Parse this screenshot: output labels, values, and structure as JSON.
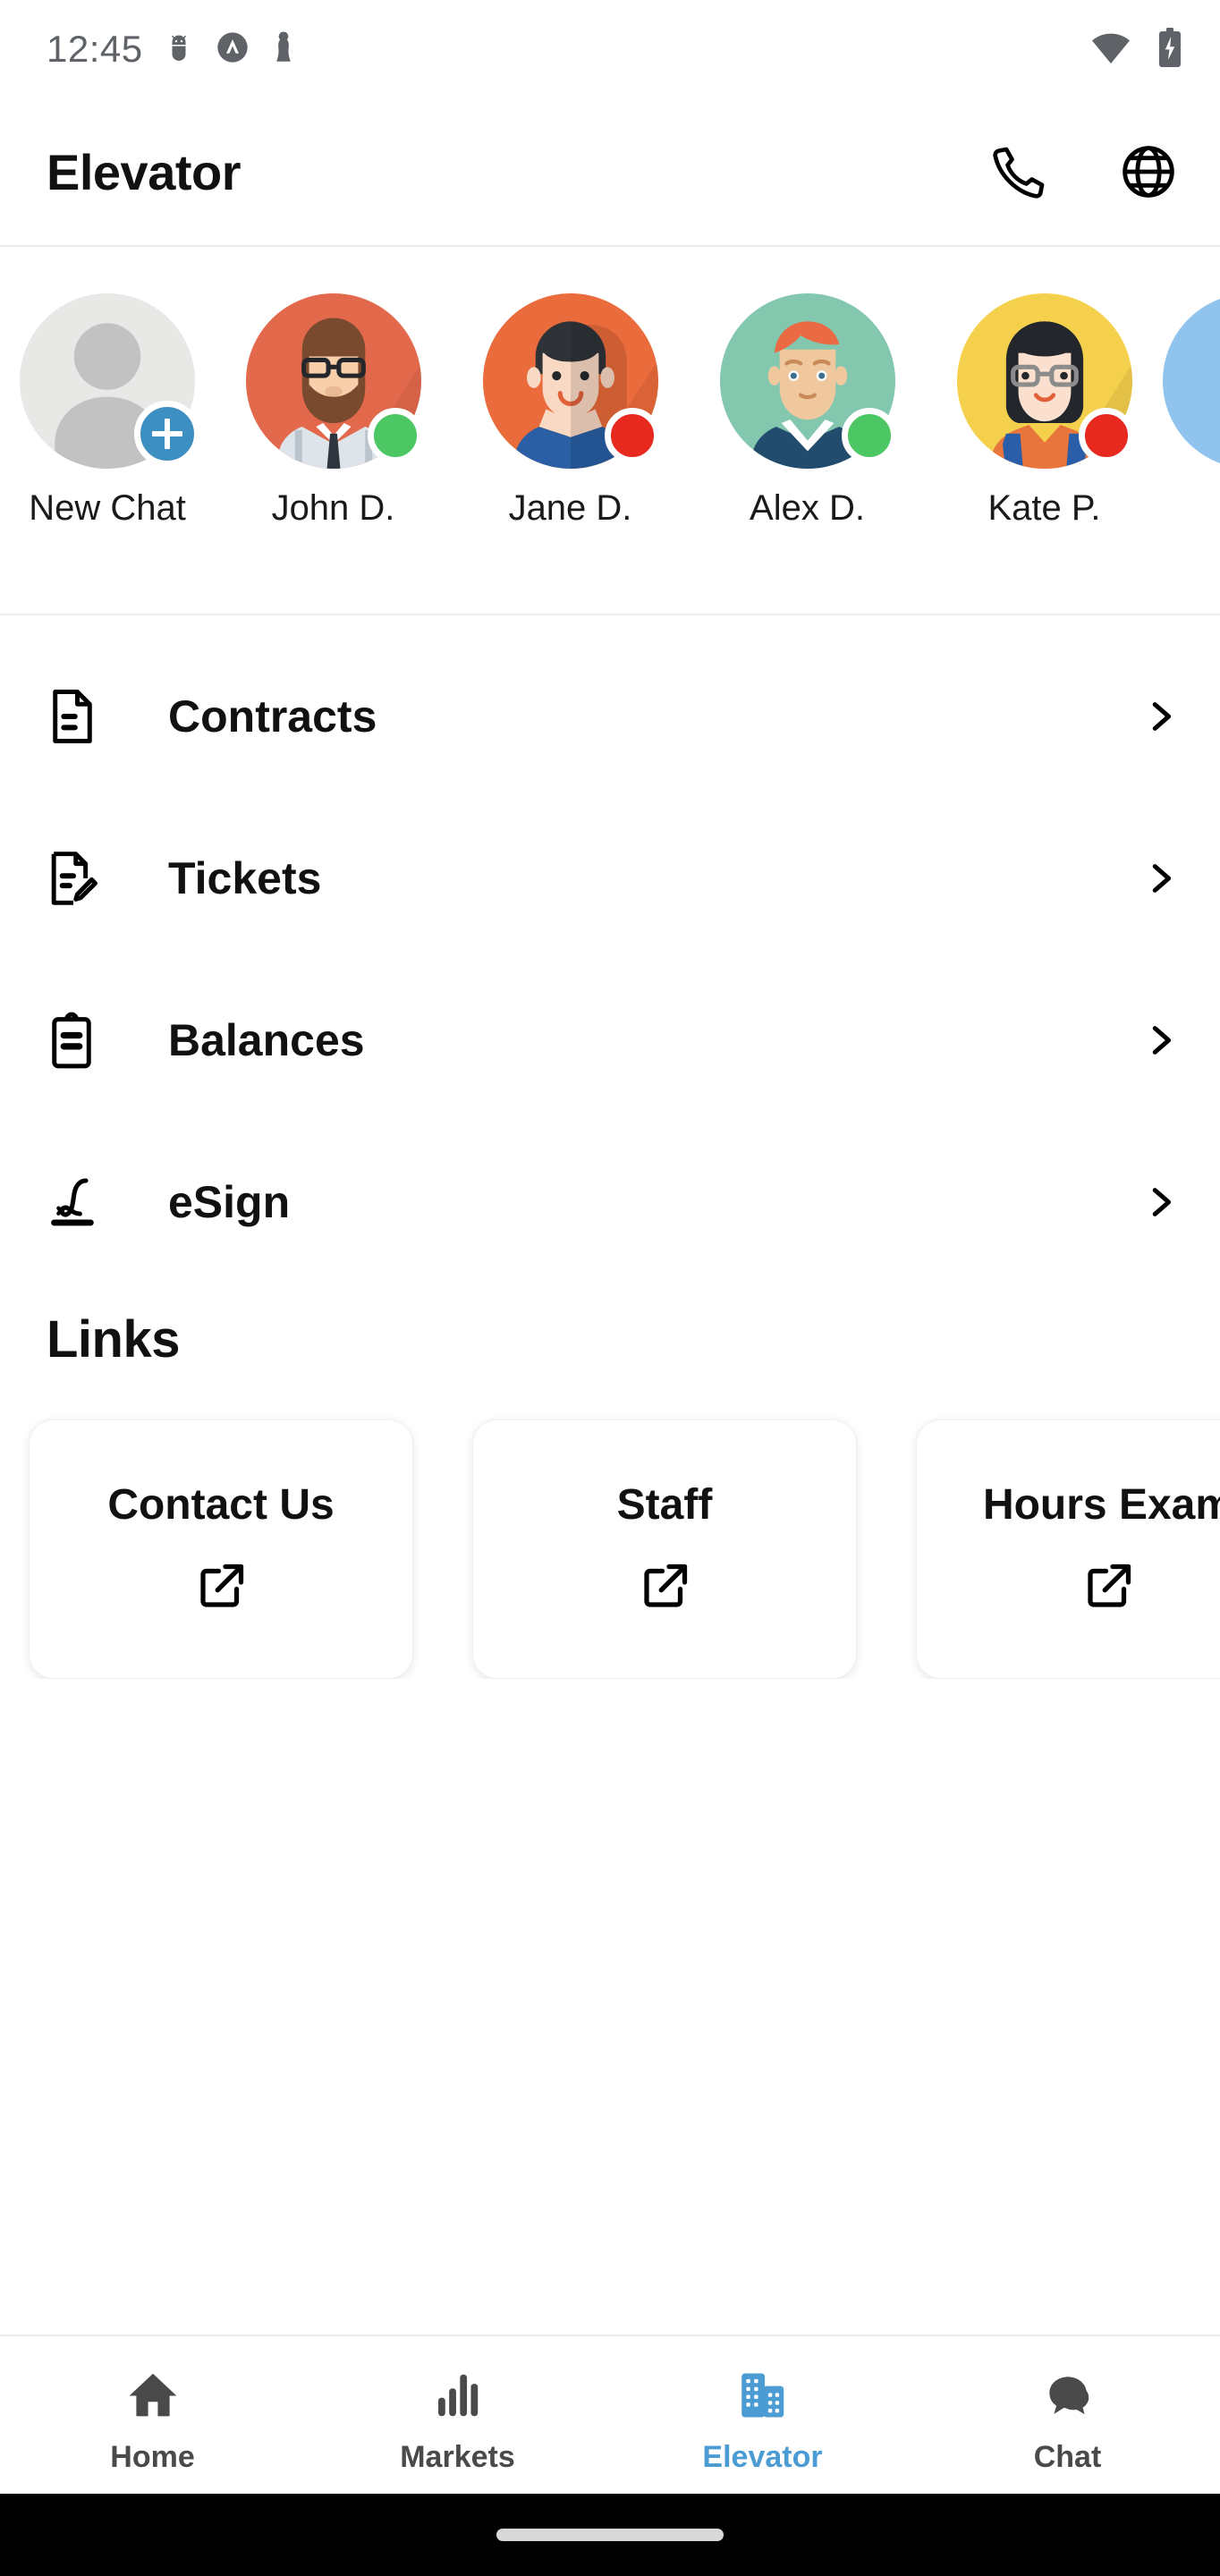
{
  "statusbar": {
    "time": "12:45",
    "left_icons": [
      "android-debug-icon",
      "vpn-key-icon",
      "chess-pawn-icon"
    ],
    "right_icons": [
      "wifi-icon",
      "battery-charging-icon"
    ]
  },
  "appbar": {
    "title": "Elevator",
    "actions": [
      {
        "name": "phone-icon",
        "label": "Call"
      },
      {
        "name": "globe-icon",
        "label": "Language"
      }
    ]
  },
  "contacts": [
    {
      "label": "New Chat",
      "type": "new",
      "badge": "plus-icon",
      "bg": "#E8E8E6",
      "status": ""
    },
    {
      "label": "John D.",
      "type": "person",
      "bg": "#E2694C",
      "status": "online",
      "status_color": "#4CC764"
    },
    {
      "label": "Jane D.",
      "type": "person",
      "bg": "#EA6B3C",
      "status": "busy",
      "status_color": "#E8291F"
    },
    {
      "label": "Alex D.",
      "type": "person",
      "bg": "#83C7AF",
      "status": "online",
      "status_color": "#4CC764"
    },
    {
      "label": "Kate P.",
      "type": "person",
      "bg": "#F5D04C",
      "status": "busy",
      "status_color": "#E8291F"
    }
  ],
  "partial_contact_color": "#90C3ED",
  "menu": [
    {
      "label": "Contracts",
      "icon": "document-icon",
      "chevron": "chevron-right-icon"
    },
    {
      "label": "Tickets",
      "icon": "document-edit-icon",
      "chevron": "chevron-right-icon"
    },
    {
      "label": "Balances",
      "icon": "clipboard-icon",
      "chevron": "chevron-right-icon"
    },
    {
      "label": "eSign",
      "icon": "signature-icon",
      "chevron": "chevron-right-icon"
    }
  ],
  "links": {
    "title": "Links",
    "cards": [
      {
        "label": "Contact Us",
        "icon": "external-link-icon"
      },
      {
        "label": "Staff",
        "icon": "external-link-icon"
      },
      {
        "label": "Hours Exam",
        "icon": "external-link-icon"
      }
    ]
  },
  "bottom_nav": {
    "active_color": "#4B9CD3",
    "inactive_color": "#4a4a4a",
    "items": [
      {
        "label": "Home",
        "icon": "home-icon",
        "active": false
      },
      {
        "label": "Markets",
        "icon": "bar-chart-icon",
        "active": false
      },
      {
        "label": "Elevator",
        "icon": "building-icon",
        "active": true
      },
      {
        "label": "Chat",
        "icon": "chat-bubble-icon",
        "active": false
      }
    ]
  }
}
